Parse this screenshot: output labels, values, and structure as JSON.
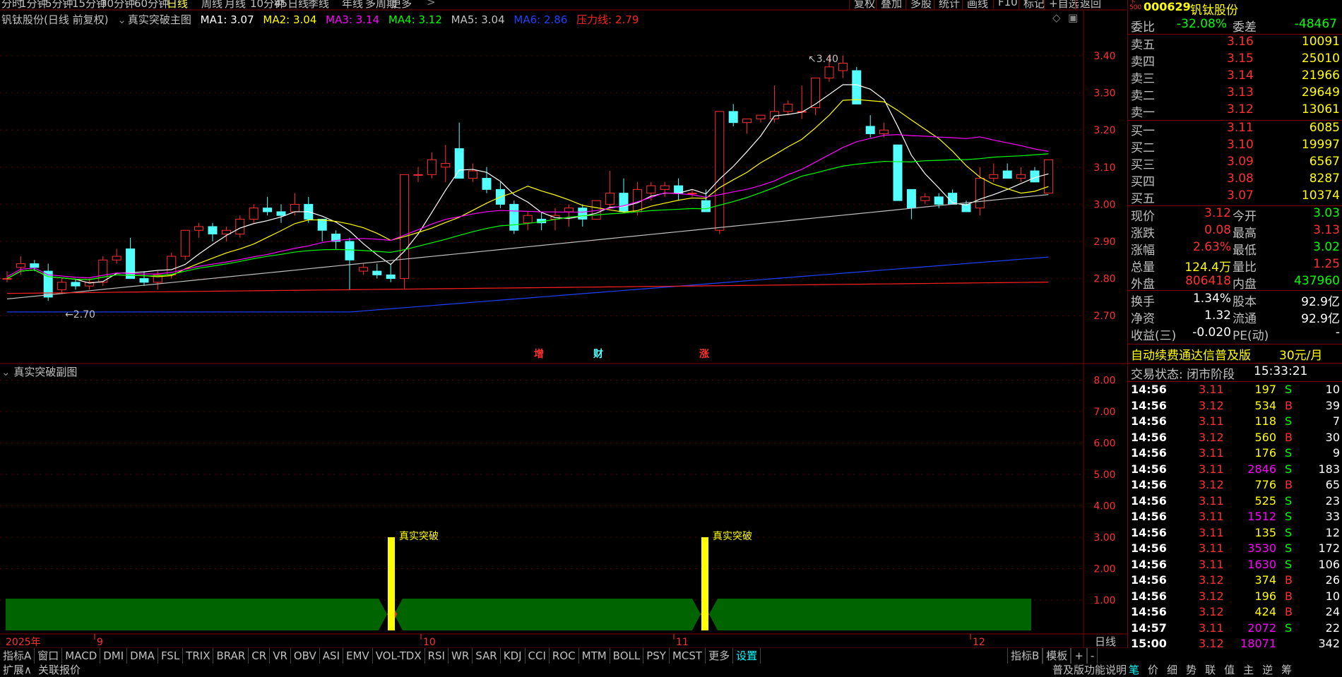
{
  "top_tabs": [
    "分时",
    "1分钟",
    "5分钟",
    "15分钟",
    "30分钟",
    "60分钟",
    "日线",
    "周线",
    "月线",
    "10分钟",
    "45日线",
    "季线",
    "年线",
    "多周期",
    "更多"
  ],
  "active_tab": "日线",
  "top_buttons": [
    "复权",
    "叠加",
    "多股",
    "统计",
    "画线",
    "F10",
    "标记",
    "+自选",
    "返回"
  ],
  "main_title": {
    "stock": "钒钛股份(日线 前复权)",
    "indicator": "真实突破主图",
    "ma1": "MA1: 3.07",
    "ma2": "MA2: 3.04",
    "ma3": "MA3: 3.14",
    "ma4": "MA4: 3.12",
    "ma5": "MA5: 3.04",
    "ma6": "MA6: 2.86",
    "pressure": "压力线: 2.79"
  },
  "sub_title": "真实突破副图",
  "price_axis": [
    "3.40",
    "3.30",
    "3.20",
    "3.10",
    "3.00",
    "2.90",
    "2.80",
    "2.70"
  ],
  "sub_axis": [
    "8.00",
    "7.00",
    "6.00",
    "5.00",
    "4.00",
    "3.00",
    "2.00",
    "1.00"
  ],
  "date_axis": [
    "2025年",
    "9",
    "10",
    "11",
    "12"
  ],
  "period_label": "日线",
  "annotations": {
    "high": "3.40",
    "low": "2.70",
    "markers": [
      "增",
      "财",
      "涨"
    ],
    "breakouts": [
      "真实突破",
      "真实突破"
    ]
  },
  "quote": {
    "code": "000629",
    "name": "钒钛股份",
    "ratio_label": "委比",
    "ratio": "-32.08%",
    "diff_label": "委差",
    "diff": "-48467"
  },
  "asks": [
    {
      "l": "卖五",
      "p": "3.16",
      "v": "10091"
    },
    {
      "l": "卖四",
      "p": "3.15",
      "v": "25010"
    },
    {
      "l": "卖三",
      "p": "3.14",
      "v": "21966"
    },
    {
      "l": "卖二",
      "p": "3.13",
      "v": "29649"
    },
    {
      "l": "卖一",
      "p": "3.12",
      "v": "13061"
    }
  ],
  "bids": [
    {
      "l": "买一",
      "p": "3.11",
      "v": "6085"
    },
    {
      "l": "买二",
      "p": "3.10",
      "v": "19997"
    },
    {
      "l": "买三",
      "p": "3.09",
      "v": "6567"
    },
    {
      "l": "买四",
      "p": "3.08",
      "v": "8287"
    },
    {
      "l": "买五",
      "p": "3.07",
      "v": "10374"
    }
  ],
  "stats": [
    {
      "l": "现价",
      "v": "3.12",
      "l2": "今开",
      "v2": "3.03"
    },
    {
      "l": "涨跌",
      "v": "0.08",
      "l2": "最高",
      "v2": "3.13"
    },
    {
      "l": "涨幅",
      "v": "2.63%",
      "l2": "最低",
      "v2": "3.02"
    },
    {
      "l": "总量",
      "v": "124.4万",
      "l2": "量比",
      "v2": "1.25"
    },
    {
      "l": "外盘",
      "v": "806418",
      "l2": "内盘",
      "v2": "437960"
    }
  ],
  "stats2": [
    {
      "l": "换手",
      "v": "1.34%",
      "l2": "股本",
      "v2": "92.9亿"
    },
    {
      "l": "净资",
      "v": "1.32",
      "l2": "流通",
      "v2": "92.9亿"
    },
    {
      "l": "收益(三)",
      "v": "-0.020",
      "l2": "PE(动)",
      "v2": "-"
    }
  ],
  "promo": {
    "text": "自动续费通达信普及版",
    "price": "30元/月"
  },
  "trade_state": {
    "label": "交易状态: 闭市阶段",
    "time": "15:33:21"
  },
  "ticks": [
    {
      "t": "14:56",
      "p": "3.11",
      "v": "197",
      "s": "S",
      "n": "10"
    },
    {
      "t": "14:56",
      "p": "3.12",
      "v": "534",
      "s": "B",
      "n": "39"
    },
    {
      "t": "14:56",
      "p": "3.11",
      "v": "118",
      "s": "S",
      "n": "7"
    },
    {
      "t": "14:56",
      "p": "3.12",
      "v": "560",
      "s": "B",
      "n": "30"
    },
    {
      "t": "14:56",
      "p": "3.11",
      "v": "176",
      "s": "S",
      "n": "9"
    },
    {
      "t": "14:56",
      "p": "3.11",
      "v": "2846",
      "s": "S",
      "n": "183"
    },
    {
      "t": "14:56",
      "p": "3.12",
      "v": "776",
      "s": "B",
      "n": "65"
    },
    {
      "t": "14:56",
      "p": "3.11",
      "v": "525",
      "s": "S",
      "n": "23"
    },
    {
      "t": "14:56",
      "p": "3.11",
      "v": "1512",
      "s": "S",
      "n": "33"
    },
    {
      "t": "14:56",
      "p": "3.11",
      "v": "135",
      "s": "S",
      "n": "12"
    },
    {
      "t": "14:56",
      "p": "3.11",
      "v": "3530",
      "s": "S",
      "n": "172"
    },
    {
      "t": "14:56",
      "p": "3.11",
      "v": "1630",
      "s": "S",
      "n": "106"
    },
    {
      "t": "14:56",
      "p": "3.12",
      "v": "374",
      "s": "B",
      "n": "26"
    },
    {
      "t": "14:56",
      "p": "3.12",
      "v": "196",
      "s": "B",
      "n": "10"
    },
    {
      "t": "14:56",
      "p": "3.12",
      "v": "424",
      "s": "B",
      "n": "24"
    },
    {
      "t": "14:57",
      "p": "3.11",
      "v": "2072",
      "s": "S",
      "n": "22"
    },
    {
      "t": "15:00",
      "p": "3.12",
      "v": "18071",
      "s": "",
      "n": "342"
    }
  ],
  "indicator_tabs": [
    "指标A",
    "窗口",
    "MACD",
    "DMI",
    "DMA",
    "FSL",
    "TRIX",
    "BRAR",
    "CR",
    "VR",
    "OBV",
    "ASI",
    "EMV",
    "VOL-TDX",
    "RSI",
    "WR",
    "SAR",
    "KDJ",
    "CCI",
    "ROC",
    "MTM",
    "BOLL",
    "PSY",
    "MCST",
    "更多",
    "设置"
  ],
  "bottom_right": [
    "指标B",
    "模板",
    "+",
    "-"
  ],
  "status": {
    "expand": "扩展∧",
    "link": "关联报价",
    "help": "普及版功能说明",
    "right_tabs": [
      "笔",
      "价",
      "细",
      "势",
      "联",
      "值",
      "主",
      "逆",
      "筹"
    ]
  },
  "chart_data": {
    "type": "candlestick",
    "candles": [
      [
        2.8,
        2.82,
        2.79,
        2.8
      ],
      [
        2.83,
        2.86,
        2.81,
        2.84
      ],
      [
        2.84,
        2.85,
        2.82,
        2.83
      ],
      [
        2.82,
        2.84,
        2.74,
        2.75
      ],
      [
        2.77,
        2.8,
        2.76,
        2.79
      ],
      [
        2.79,
        2.8,
        2.77,
        2.78
      ],
      [
        2.78,
        2.8,
        2.77,
        2.79
      ],
      [
        2.79,
        2.86,
        2.78,
        2.85
      ],
      [
        2.85,
        2.88,
        2.84,
        2.86
      ],
      [
        2.88,
        2.91,
        2.8,
        2.8
      ],
      [
        2.8,
        2.82,
        2.78,
        2.79
      ],
      [
        2.79,
        2.82,
        2.77,
        2.81
      ],
      [
        2.81,
        2.87,
        2.8,
        2.86
      ],
      [
        2.86,
        2.93,
        2.85,
        2.93
      ],
      [
        2.93,
        2.95,
        2.91,
        2.94
      ],
      [
        2.94,
        2.95,
        2.9,
        2.92
      ],
      [
        2.92,
        2.94,
        2.9,
        2.93
      ],
      [
        2.92,
        2.97,
        2.91,
        2.96
      ],
      [
        2.96,
        3.0,
        2.95,
        2.99
      ],
      [
        2.99,
        3.02,
        2.97,
        2.98
      ],
      [
        2.98,
        3.0,
        2.95,
        2.97
      ],
      [
        2.98,
        3.03,
        2.97,
        3.0
      ],
      [
        3.0,
        3.02,
        2.95,
        2.96
      ],
      [
        2.96,
        2.96,
        2.9,
        2.93
      ],
      [
        2.92,
        2.93,
        2.88,
        2.9
      ],
      [
        2.9,
        2.91,
        2.77,
        2.85
      ],
      [
        2.82,
        2.84,
        2.81,
        2.83
      ],
      [
        2.82,
        2.84,
        2.8,
        2.81
      ],
      [
        2.81,
        2.84,
        2.79,
        2.8
      ],
      [
        2.8,
        3.08,
        2.77,
        3.08
      ],
      [
        3.08,
        3.1,
        3.06,
        3.08
      ],
      [
        3.08,
        3.14,
        3.07,
        3.12
      ],
      [
        3.1,
        3.16,
        3.06,
        3.11
      ],
      [
        3.15,
        3.22,
        3.07,
        3.07
      ],
      [
        3.07,
        3.11,
        3.06,
        3.09
      ],
      [
        3.07,
        3.1,
        3.03,
        3.04
      ],
      [
        3.04,
        3.06,
        2.99,
        3.0
      ],
      [
        3.0,
        3.01,
        2.92,
        2.93
      ],
      [
        2.95,
        2.98,
        2.93,
        2.97
      ],
      [
        2.96,
        2.98,
        2.93,
        2.95
      ],
      [
        2.96,
        2.99,
        2.93,
        2.97
      ],
      [
        2.98,
        3.0,
        2.94,
        2.99
      ],
      [
        2.99,
        3.0,
        2.94,
        2.96
      ],
      [
        2.96,
        3.01,
        2.96,
        3.01
      ],
      [
        3.0,
        3.09,
        2.99,
        3.03
      ],
      [
        3.03,
        3.07,
        2.98,
        2.98
      ],
      [
        2.98,
        3.06,
        2.97,
        3.04
      ],
      [
        3.03,
        3.06,
        3.01,
        3.05
      ],
      [
        3.04,
        3.06,
        3.02,
        3.05
      ],
      [
        3.05,
        3.07,
        3.01,
        3.03
      ],
      [
        3.03,
        3.04,
        3.02,
        3.03
      ],
      [
        3.01,
        3.04,
        2.98,
        2.98
      ],
      [
        2.93,
        3.25,
        2.92,
        3.25
      ],
      [
        3.25,
        3.27,
        3.21,
        3.22
      ],
      [
        3.22,
        3.23,
        3.19,
        3.23
      ],
      [
        3.23,
        3.24,
        3.22,
        3.24
      ],
      [
        3.23,
        3.32,
        3.22,
        3.25
      ],
      [
        3.25,
        3.28,
        3.24,
        3.27
      ],
      [
        3.25,
        3.32,
        3.23,
        3.25
      ],
      [
        3.26,
        3.34,
        3.24,
        3.34
      ],
      [
        3.34,
        3.4,
        3.33,
        3.37
      ],
      [
        3.36,
        3.4,
        3.34,
        3.38
      ],
      [
        3.36,
        3.37,
        3.27,
        3.27
      ],
      [
        3.21,
        3.24,
        3.18,
        3.19
      ],
      [
        3.19,
        3.22,
        3.18,
        3.2
      ],
      [
        3.16,
        3.16,
        3.01,
        3.01
      ],
      [
        3.04,
        3.04,
        2.96,
        2.99
      ],
      [
        3.01,
        3.03,
        3.0,
        3.02
      ],
      [
        3.02,
        3.03,
        2.99,
        3.0
      ],
      [
        3.03,
        3.04,
        3.0,
        3.0
      ],
      [
        3.0,
        3.01,
        2.98,
        2.98
      ],
      [
        2.99,
        3.1,
        2.97,
        3.07
      ],
      [
        3.07,
        3.11,
        3.06,
        3.08
      ],
      [
        3.09,
        3.11,
        3.07,
        3.07
      ],
      [
        3.07,
        3.1,
        3.06,
        3.08
      ],
      [
        3.09,
        3.1,
        3.07,
        3.06
      ],
      [
        3.03,
        3.12,
        3.03,
        3.12
      ]
    ]
  }
}
